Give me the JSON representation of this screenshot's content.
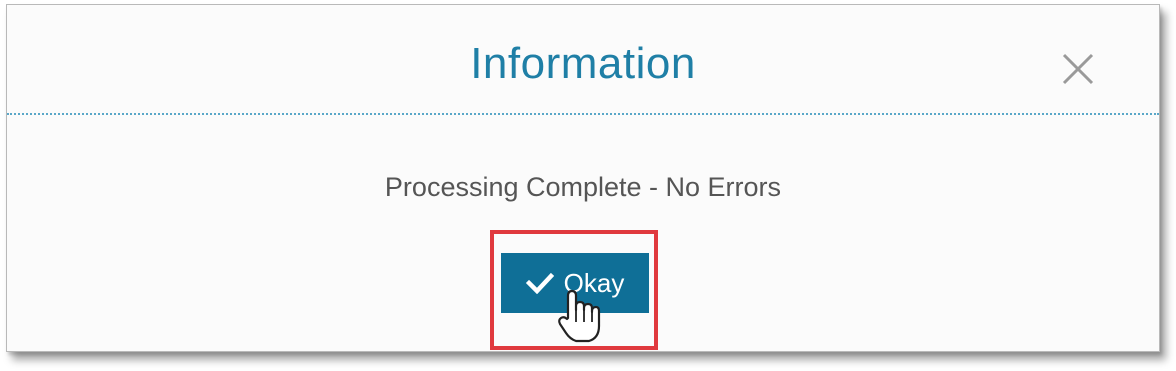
{
  "dialog": {
    "title": "Information",
    "close_icon": "close-icon",
    "message": "Processing Complete - No Errors",
    "okay_button": {
      "label": "Okay",
      "icon": "check-icon"
    }
  },
  "colors": {
    "title": "#1f7fa6",
    "divider": "#5aa7c8",
    "button_bg": "#0f6f97",
    "button_text": "#ffffff",
    "message_text": "#555555",
    "highlight": "#e0393e"
  },
  "overlay": {
    "cursor_icon": "hand-pointer-icon"
  }
}
